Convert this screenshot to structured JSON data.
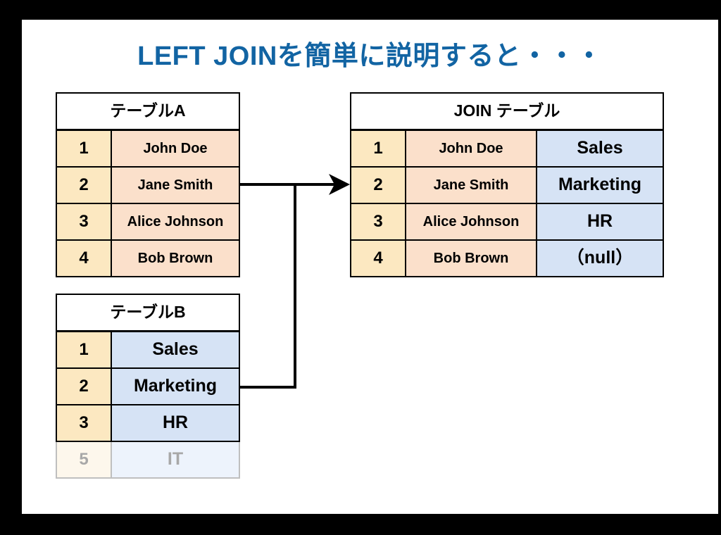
{
  "slide": {
    "title": "LEFT JOINを簡単に説明すると・・・",
    "title_color": "#1264A3",
    "background_color": "#000000",
    "canvas_color": "#ffffff"
  },
  "colors": {
    "id_cell": "#FCE8C1",
    "name_cell": "#FBE0CB",
    "dept_cell": "#D6E3F5",
    "header_cell": "#ffffff",
    "border": "#000000",
    "faded_text": "#A8A8A8",
    "faded_border": "#BFBFBF",
    "faded_id_cell": "#FDF7EC",
    "faded_dept_cell": "#EDF3FC",
    "connector": "#000000"
  },
  "table_a": {
    "title": "テーブルA",
    "rows": [
      {
        "id": "1",
        "name": "John Doe"
      },
      {
        "id": "2",
        "name": "Jane Smith"
      },
      {
        "id": "3",
        "name": "Alice Johnson"
      },
      {
        "id": "4",
        "name": "Bob Brown"
      }
    ]
  },
  "table_b": {
    "title": "テーブルB",
    "rows": [
      {
        "id": "1",
        "dept": "Sales",
        "faded": false
      },
      {
        "id": "2",
        "dept": "Marketing",
        "faded": false
      },
      {
        "id": "3",
        "dept": "HR",
        "faded": false
      },
      {
        "id": "5",
        "dept": "IT",
        "faded": true
      }
    ]
  },
  "table_join": {
    "title": "JOIN テーブル",
    "rows": [
      {
        "id": "1",
        "name": "John Doe",
        "dept": "Sales"
      },
      {
        "id": "2",
        "name": "Jane Smith",
        "dept": "Marketing"
      },
      {
        "id": "3",
        "name": "Alice Johnson",
        "dept": "HR"
      },
      {
        "id": "4",
        "name": "Bob Brown",
        "dept": "（null）"
      }
    ]
  },
  "connectors": {
    "arrow_label": "join-arrow",
    "from_table_a": "テーブルA",
    "from_table_b": "テーブルB",
    "to_table": "JOIN テーブル"
  }
}
